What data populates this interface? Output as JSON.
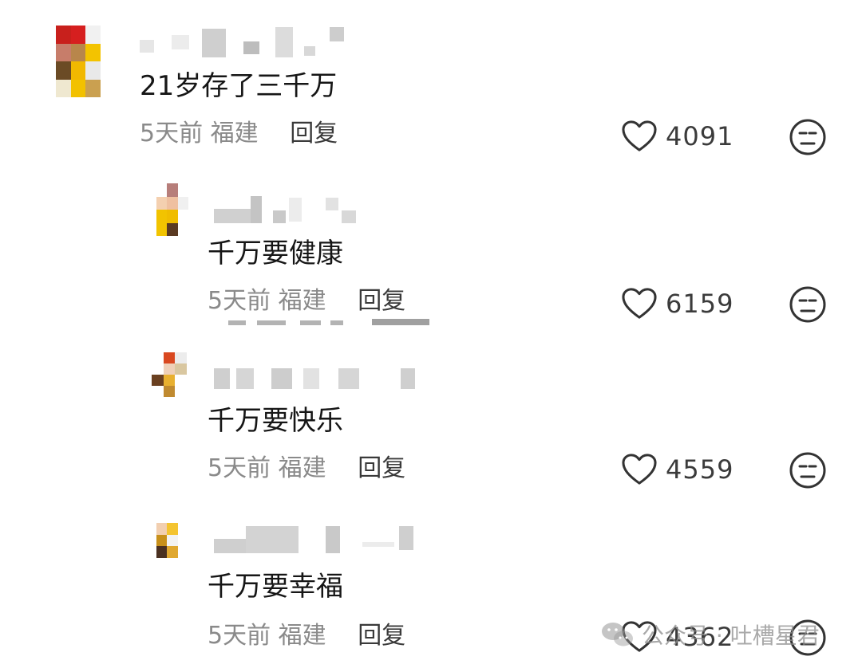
{
  "comments": [
    {
      "text": "21岁存了三千万",
      "time": "5天前",
      "location": "福建",
      "reply_label": "回复",
      "likes": "4091"
    },
    {
      "text": "千万要健康",
      "time": "5天前",
      "location": "福建",
      "reply_label": "回复",
      "likes": "6159"
    },
    {
      "text": "千万要快乐",
      "time": "5天前",
      "location": "福建",
      "reply_label": "回复",
      "likes": "4559"
    },
    {
      "text": "千万要幸福",
      "time": "5天前",
      "location": "福建",
      "reply_label": "回复",
      "likes": "4362"
    }
  ],
  "watermark": {
    "text": "公众号 · 吐槽星君",
    "icon": "wechat-icon"
  },
  "icons": {
    "like": "heart-icon",
    "dislike": "meh-face-icon"
  },
  "colors": {
    "text": "#161616",
    "meta": "#8a8a8a",
    "reply": "#3a3a3a",
    "icon": "#333333"
  }
}
